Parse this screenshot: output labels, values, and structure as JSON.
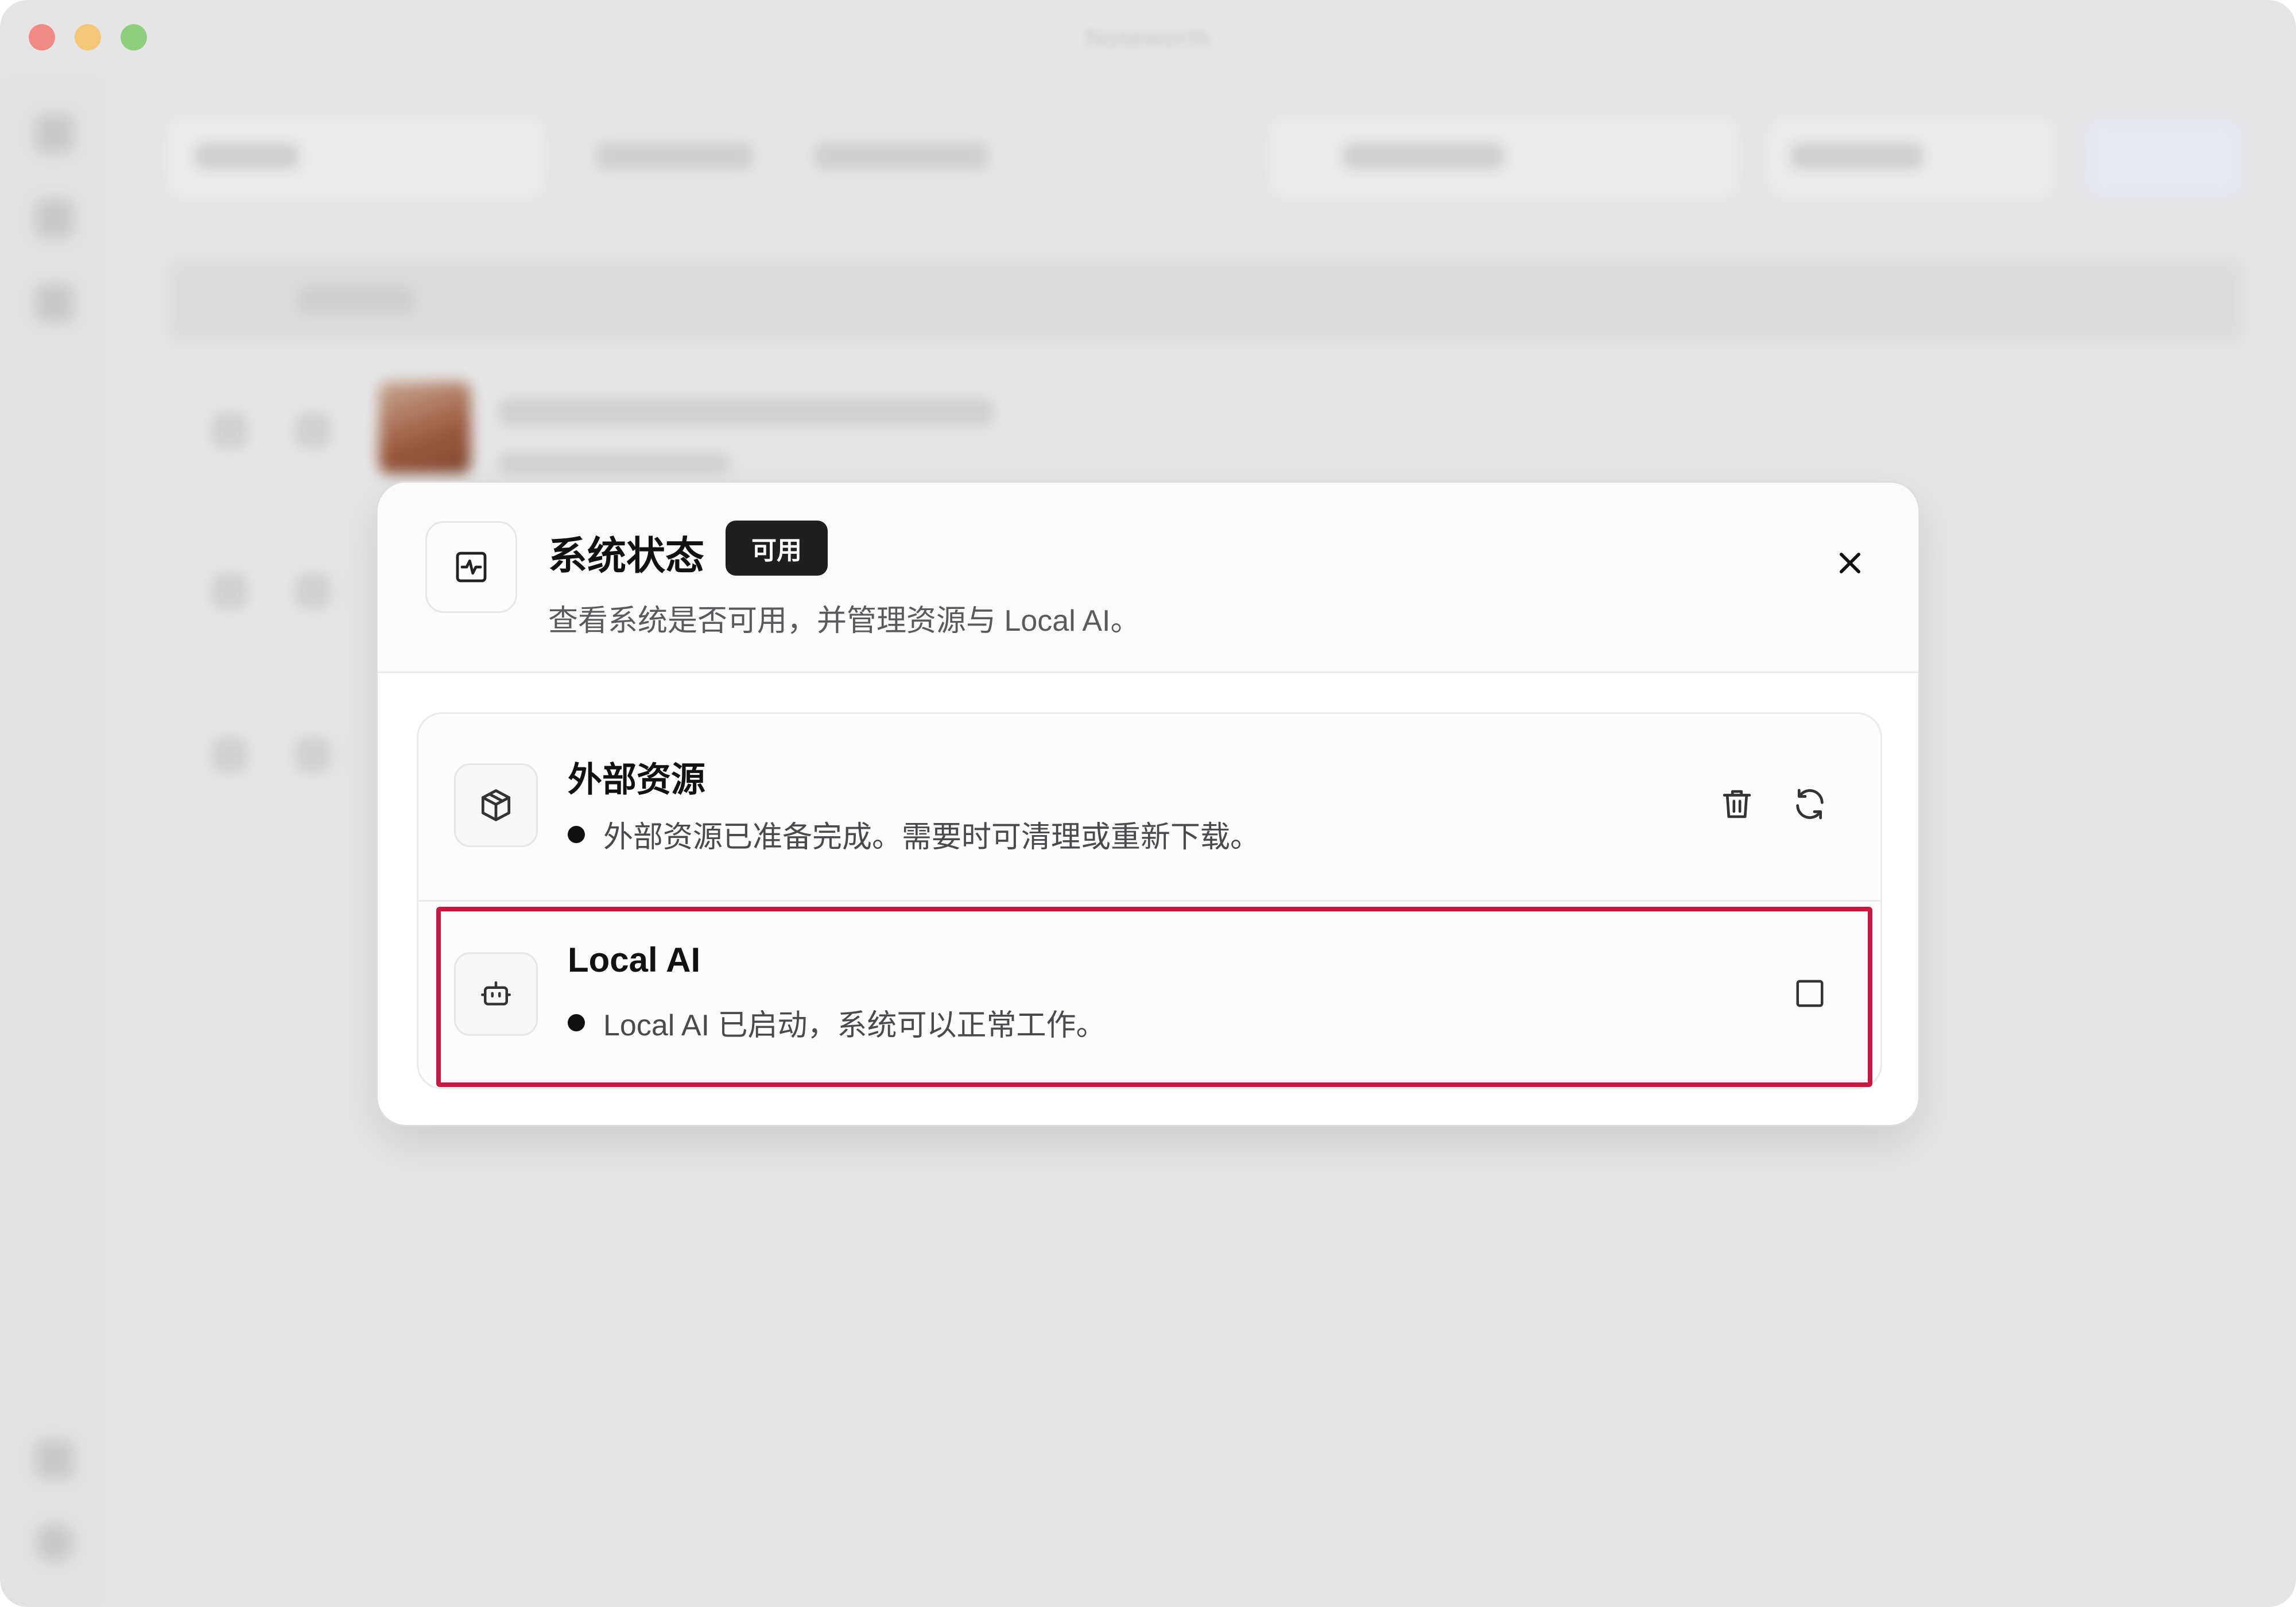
{
  "window": {
    "title": "Noteworth"
  },
  "dialog": {
    "title": "系统状态",
    "badge": "可用",
    "subtitle": "查看系统是否可用，并管理资源与 Local AI。",
    "items": [
      {
        "title": "外部资源",
        "status": "外部资源已准备完成。需要时可清理或重新下载。",
        "icon": "package-icon",
        "actions": [
          "trash-icon",
          "refresh-icon"
        ]
      },
      {
        "title": "Local AI",
        "status": "Local AI 已启动，系统可以正常工作。",
        "icon": "robot-icon",
        "actions": [
          "stop-icon"
        ]
      }
    ]
  },
  "colors": {
    "highlight": "#c8183f",
    "badge_bg": "#1f1f21",
    "window_bg": "#e5e5e6"
  }
}
